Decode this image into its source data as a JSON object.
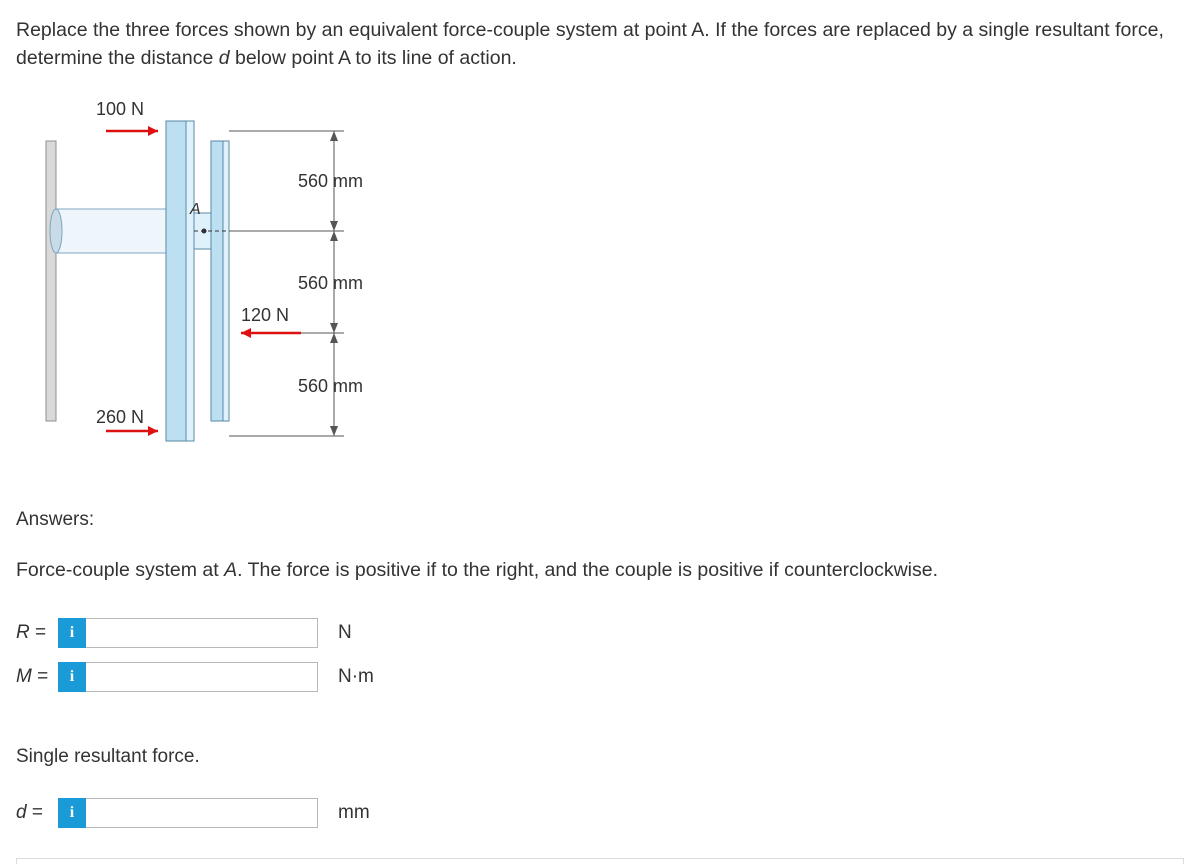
{
  "problem": {
    "text_before_d": "Replace the three forces shown by an equivalent force-couple system at point A. If the forces are replaced by a single resultant force, determine the distance ",
    "d": "d",
    "text_after_d": " below point A to its line of action."
  },
  "diagram": {
    "force_top": "100 N",
    "force_mid": "120 N",
    "force_bot": "260 N",
    "point_label": "A",
    "dim1": "560 mm",
    "dim2": "560 mm",
    "dim3": "560 mm"
  },
  "answers": {
    "heading": "Answers:",
    "hint_before_A": "Force-couple system at ",
    "hint_A": "A",
    "hint_after_A": ". The force is positive if to the right, and the couple is positive if counterclockwise.",
    "rows": [
      {
        "label": "R",
        "eq": "=",
        "unit": "N"
      },
      {
        "label": "M",
        "eq": "=",
        "unit": "N·m"
      }
    ],
    "single_label": "Single resultant force.",
    "row_d": {
      "label": "d",
      "eq": "=",
      "unit": "mm"
    },
    "info_glyph": "i"
  }
}
